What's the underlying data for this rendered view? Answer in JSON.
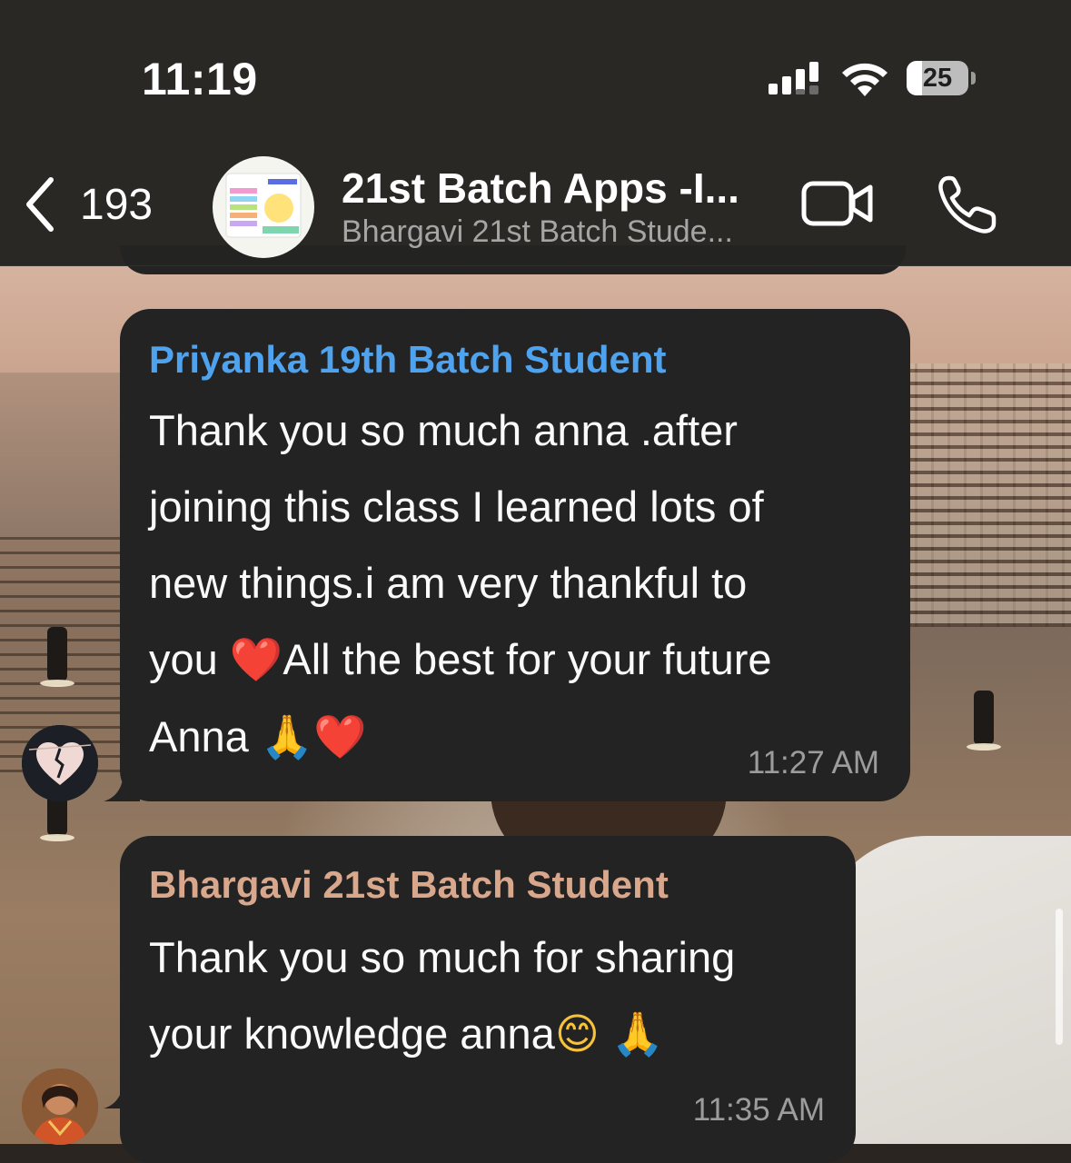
{
  "status_bar": {
    "time": "11:19",
    "battery_level": "25",
    "battery_fraction": 0.25,
    "icons": [
      "signal-icon",
      "wifi-icon",
      "battery-icon"
    ]
  },
  "header": {
    "back_count": "193",
    "title": "21st Batch Apps -I...",
    "subtitle": "Bhargavi 21st Batch Stude...",
    "icons": [
      "chevron-left-icon",
      "group-avatar",
      "video-camera-icon",
      "phone-icon"
    ]
  },
  "messages": [
    {
      "sender": "Priyanka 19th Batch Student",
      "sender_color": "#4fa3ee",
      "lines": [
        "Thank you so much anna .after",
        "joining this class I learned lots of",
        "new things.i am very thankful to"
      ],
      "line4_a": "you ",
      "line4_emoji": "❤️",
      "line4_b": "All the best for your future",
      "line5_a": "Anna ",
      "line5_emoji_1": "🙏",
      "line5_emoji_2": "❤️",
      "time": "11:27 AM"
    },
    {
      "sender": "Bhargavi 21st Batch Student",
      "sender_color": "#d9a88c",
      "line1": "Thank you so much for sharing",
      "line2_a": "your knowledge anna",
      "line2_emoji_1": "😊",
      "line2_emoji_2": "🙏",
      "time": "11:35 AM"
    }
  ],
  "colors": {
    "bubble": "#232323",
    "header": "#232321",
    "timestamp": "#9c9c9c"
  }
}
